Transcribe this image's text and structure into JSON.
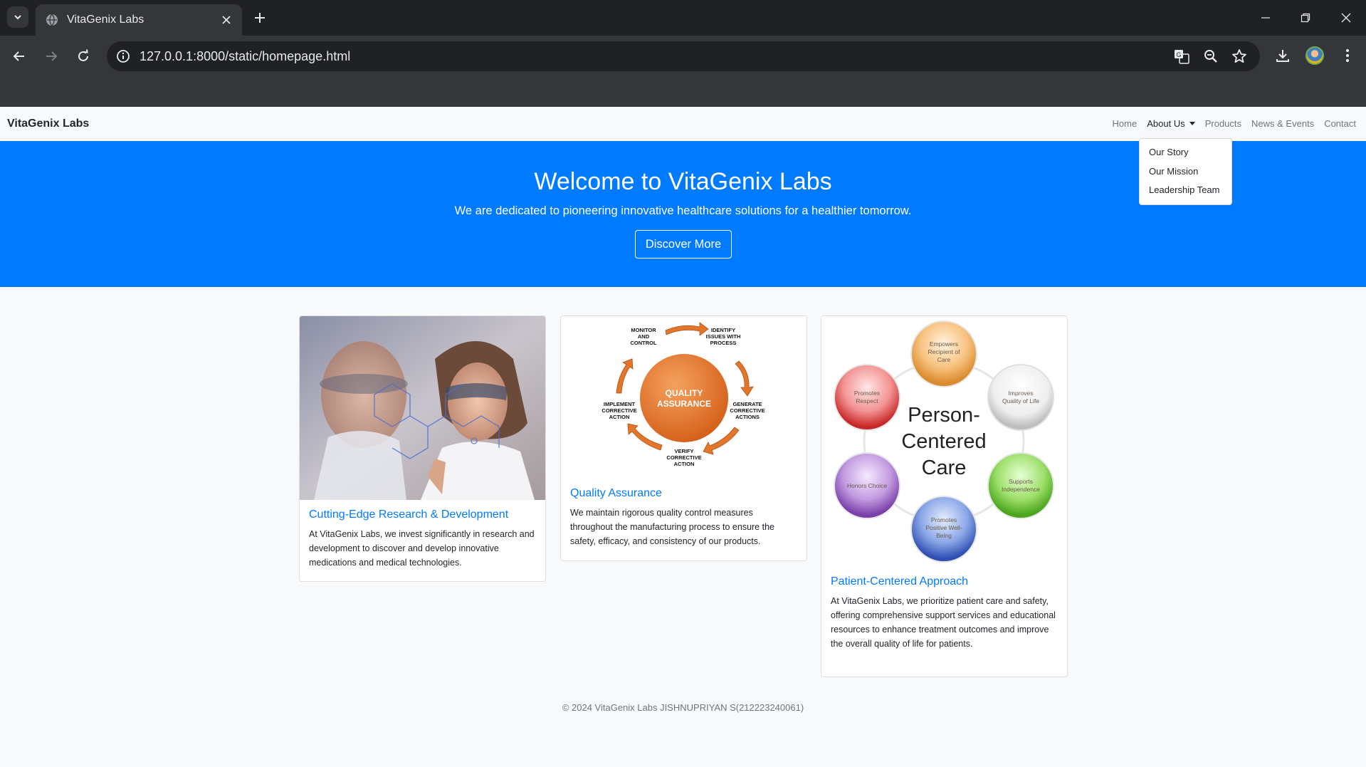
{
  "browser": {
    "tab_title": "VitaGenix Labs",
    "url": "127.0.0.1:8000/static/homepage.html"
  },
  "navbar": {
    "brand": "VitaGenix Labs",
    "links": {
      "home": "Home",
      "about": "About Us",
      "products": "Products",
      "news": "News & Events",
      "contact": "Contact"
    },
    "dropdown": {
      "story": "Our Story",
      "mission": "Our Mission",
      "team": "Leadership Team"
    }
  },
  "hero": {
    "title": "Welcome to VitaGenix Labs",
    "subtitle": "We are dedicated to pioneering innovative healthcare solutions for a healthier tomorrow.",
    "button": "Discover More"
  },
  "cards": {
    "research": {
      "title": "Cutting-Edge Research & Development",
      "text": "At VitaGenix Labs, we invest significantly in research and development to discover and develop innovative medications and medical technologies."
    },
    "quality": {
      "title": "Quality Assurance",
      "text": "We maintain rigorous quality control measures throughout the manufacturing process to ensure the safety, efficacy, and consistency of our products.",
      "diagram": {
        "center": [
          "QUALITY",
          "ASSURANCE"
        ],
        "monitor": [
          "MONITOR",
          "AND",
          "CONTROL"
        ],
        "identify": [
          "IDENTIFY",
          "ISSUES WITH",
          "PROCESS"
        ],
        "generate": [
          "GENERATE",
          "CORRECTIVE",
          "ACTIONS"
        ],
        "verify": [
          "VERIFY",
          "CORRECTIVE",
          "ACTION"
        ],
        "implement": [
          "IMPLEMENT",
          "CORRECTIVE",
          "ACTION"
        ]
      }
    },
    "patient": {
      "title": "Patient-Centered Approach",
      "text": "At VitaGenix Labs, we prioritize patient care and safety, offering comprehensive support services and educational resources to enhance treatment outcomes and improve the overall quality of life for patients.",
      "diagram": {
        "center": [
          "Person-",
          "Centered",
          "Care"
        ],
        "empowers": [
          "Empowers",
          "Recipient of",
          "Care"
        ],
        "improves": [
          "Improves",
          "Quality of Life"
        ],
        "supports": [
          "Supports",
          "Independence"
        ],
        "wellbeing": [
          "Promotes",
          "Positive Well-",
          "Being"
        ],
        "choice": [
          "Honors Choice"
        ],
        "respect": [
          "Promotes",
          "Respect"
        ]
      }
    }
  },
  "footer": "© 2024 VitaGenix Labs JISHNUPRIYAN S(212223240061)",
  "colors": {
    "primary": "#007bff",
    "qa_orange": "#e2762a"
  }
}
